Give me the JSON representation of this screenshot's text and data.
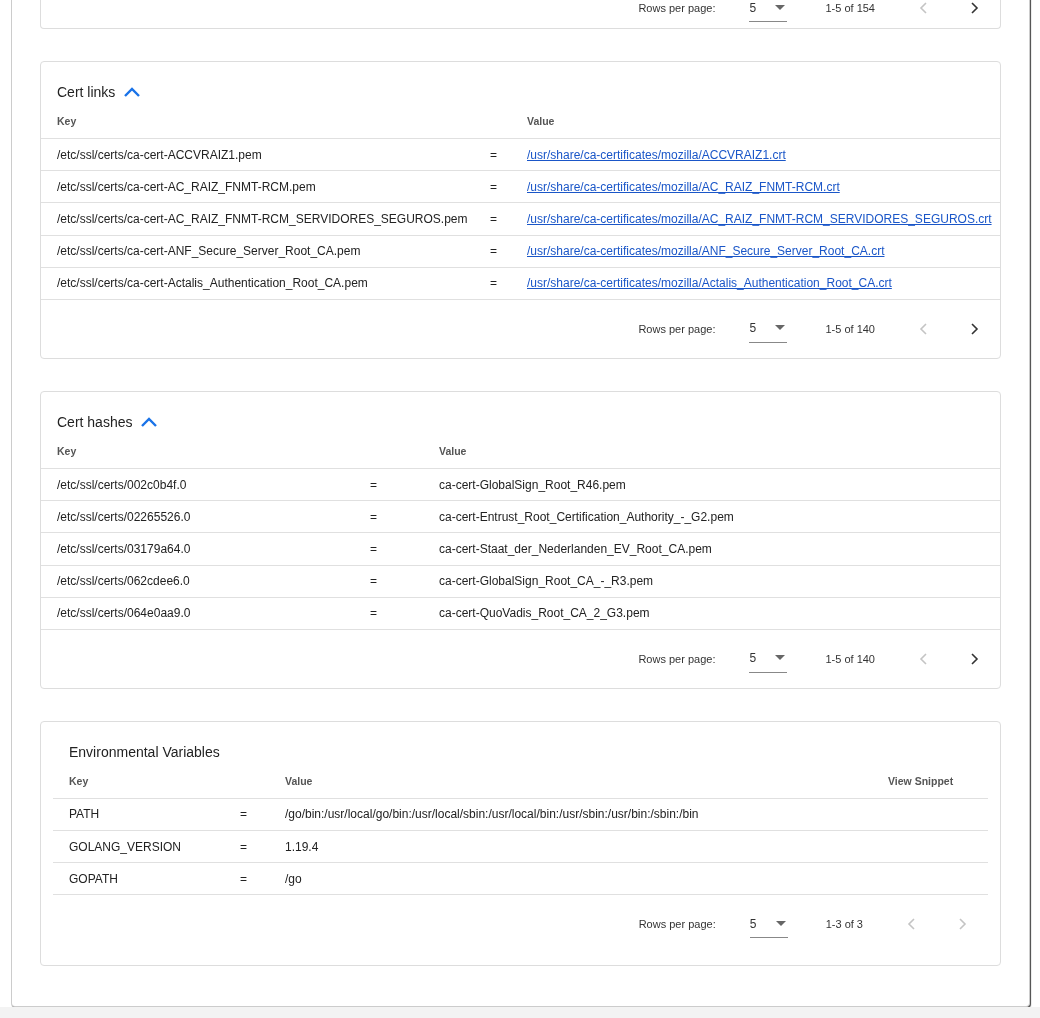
{
  "top_card": {
    "pagination": {
      "rows_per_page_label": "Rows per page:",
      "rows_per_page": "5",
      "range": "1-5 of 154",
      "prev_disabled": true,
      "next_disabled": false
    }
  },
  "sections": [
    {
      "title": "Cert links",
      "expanded": true,
      "columns": [
        "Key",
        "Value"
      ],
      "rows": [
        {
          "kind": "link",
          "key": "/etc/ssl/certs/ca-cert-ACCVRAIZ1.pem",
          "sep": "=",
          "value": "/usr/share/ca-certificates/mozilla/ACCVRAIZ1.crt"
        },
        {
          "kind": "link",
          "key": "/etc/ssl/certs/ca-cert-AC_RAIZ_FNMT-RCM.pem",
          "sep": "=",
          "value": "/usr/share/ca-certificates/mozilla/AC_RAIZ_FNMT-RCM.crt"
        },
        {
          "kind": "link",
          "key": "/etc/ssl/certs/ca-cert-AC_RAIZ_FNMT-RCM_SERVIDORES_SEGUROS.pem",
          "sep": "=",
          "value": "/usr/share/ca-certificates/mozilla/AC_RAIZ_FNMT-RCM_SERVIDORES_SEGUROS.crt"
        },
        {
          "kind": "link",
          "key": "/etc/ssl/certs/ca-cert-ANF_Secure_Server_Root_CA.pem",
          "sep": "=",
          "value": "/usr/share/ca-certificates/mozilla/ANF_Secure_Server_Root_CA.crt"
        },
        {
          "kind": "link",
          "key": "/etc/ssl/certs/ca-cert-Actalis_Authentication_Root_CA.pem",
          "sep": "=",
          "value": "/usr/share/ca-certificates/mozilla/Actalis_Authentication_Root_CA.crt"
        }
      ],
      "pagination": {
        "rows_per_page_label": "Rows per page:",
        "rows_per_page": "5",
        "range": "1-5 of 140",
        "prev_disabled": true,
        "next_disabled": false
      }
    },
    {
      "title": "Cert hashes",
      "expanded": true,
      "columns": [
        "Key",
        "Value"
      ],
      "rows": [
        {
          "kind": "text",
          "key": "/etc/ssl/certs/002c0b4f.0",
          "sep": "=",
          "value": "ca-cert-GlobalSign_Root_R46.pem"
        },
        {
          "kind": "text",
          "key": "/etc/ssl/certs/02265526.0",
          "sep": "=",
          "value": "ca-cert-Entrust_Root_Certification_Authority_-_G2.pem"
        },
        {
          "kind": "text",
          "key": "/etc/ssl/certs/03179a64.0",
          "sep": "=",
          "value": "ca-cert-Staat_der_Nederlanden_EV_Root_CA.pem"
        },
        {
          "kind": "text",
          "key": "/etc/ssl/certs/062cdee6.0",
          "sep": "=",
          "value": "ca-cert-GlobalSign_Root_CA_-_R3.pem"
        },
        {
          "kind": "text",
          "key": "/etc/ssl/certs/064e0aa9.0",
          "sep": "=",
          "value": "ca-cert-QuoVadis_Root_CA_2_G3.pem"
        }
      ],
      "pagination": {
        "rows_per_page_label": "Rows per page:",
        "rows_per_page": "5",
        "range": "1-5 of 140",
        "prev_disabled": true,
        "next_disabled": false
      }
    },
    {
      "title": "Environmental Variables",
      "columns": [
        "Key",
        "Value",
        "View Snippet"
      ],
      "rows": [
        {
          "kind": "text",
          "key": "PATH",
          "sep": "=",
          "value": "/go/bin:/usr/local/go/bin:/usr/local/sbin:/usr/local/bin:/usr/sbin:/usr/bin:/sbin:/bin"
        },
        {
          "kind": "text",
          "key": "GOLANG_VERSION",
          "sep": "=",
          "value": "1.19.4"
        },
        {
          "kind": "text",
          "key": "GOPATH",
          "sep": "=",
          "value": "/go"
        }
      ],
      "pagination": {
        "rows_per_page_label": "Rows per page:",
        "rows_per_page": "5",
        "range": "1-3 of 3",
        "prev_disabled": true,
        "next_disabled": true
      }
    }
  ]
}
